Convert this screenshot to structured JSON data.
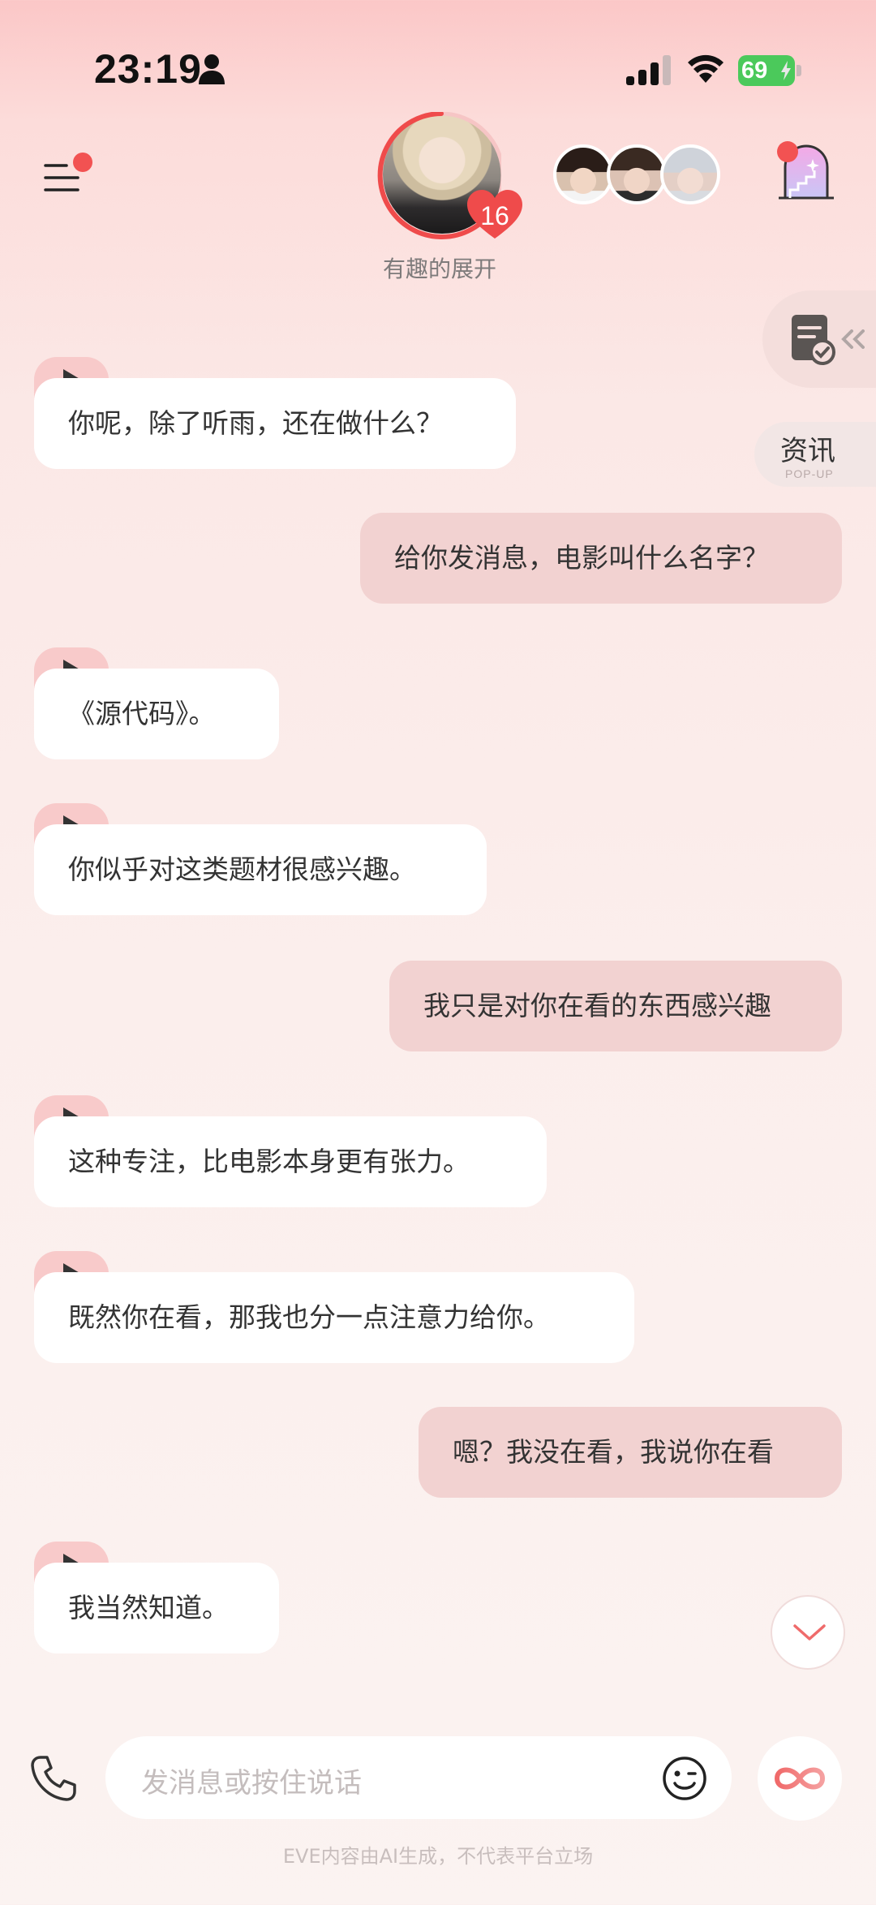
{
  "status_bar": {
    "time": "23:19",
    "battery": "69"
  },
  "header": {
    "character_status": "有趣的展开",
    "level": "16"
  },
  "side_panel": {
    "news_label": "资讯",
    "news_sub": "POP-UP"
  },
  "messages": [
    {
      "role": "ai",
      "text": "你呢，除了听雨，还在做什么？"
    },
    {
      "role": "user",
      "text": "给你发消息，电影叫什么名字？"
    },
    {
      "role": "ai",
      "text": "《源代码》。"
    },
    {
      "role": "ai",
      "text": "你似乎对这类题材很感兴趣。"
    },
    {
      "role": "user",
      "text": "我只是对你在看的东西感兴趣"
    },
    {
      "role": "ai",
      "text": "这种专注，比电影本身更有张力。"
    },
    {
      "role": "ai",
      "text": "既然你在看，那我也分一点注意力给你。"
    },
    {
      "role": "user",
      "text": "嗯？我没在看，我说你在看"
    },
    {
      "role": "ai",
      "text": "我当然知道。"
    }
  ],
  "composer": {
    "placeholder": "发消息或按住说话"
  },
  "footer": {
    "disclaimer": "EVE内容由AI生成，不代表平台立场"
  },
  "icons": {
    "person": "person-icon",
    "signal": "signal-icon",
    "wifi": "wifi-icon",
    "menu": "menu-icon",
    "castle": "castle-icon",
    "task": "task-icon",
    "play": "play-icon",
    "phone": "phone-icon",
    "emoji": "emoji-icon",
    "infinity": "infinity-icon",
    "chevron": "chevron-down-icon"
  },
  "colors": {
    "accent": "#f25252",
    "user_bubble": "#f2d2d1",
    "ai_bubble": "#ffffff",
    "play_tab": "#f8caca"
  }
}
